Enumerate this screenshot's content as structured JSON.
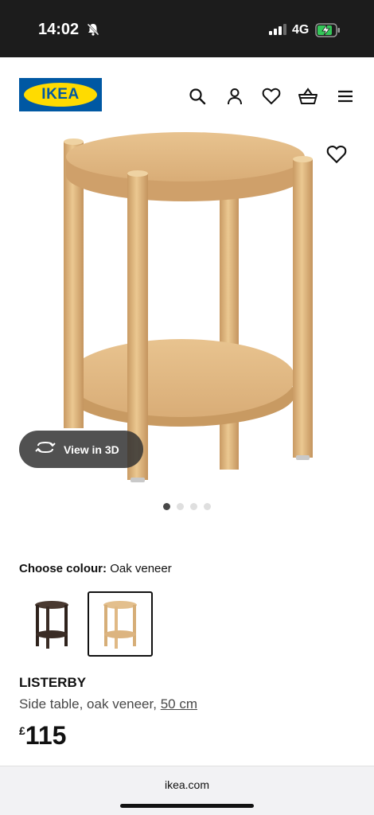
{
  "status": {
    "time": "14:02",
    "network": "4G"
  },
  "header": {
    "logo_text": "IKEA"
  },
  "gallery": {
    "view_3d_label": "View in 3D",
    "slide_count": 4,
    "active_slide": 1
  },
  "colour": {
    "label": "Choose colour:",
    "value": "Oak veneer",
    "options": [
      "dark-brown",
      "oak-veneer"
    ],
    "selected": "oak-veneer"
  },
  "product": {
    "name": "LISTERBY",
    "description": "Side table, oak veneer,",
    "size": "50 cm",
    "currency": "£",
    "price": "115"
  },
  "browser": {
    "url": "ikea.com"
  },
  "colors": {
    "brand_blue": "#0058a3",
    "brand_yellow": "#ffdb00",
    "oak": "#e3bf8d",
    "dark": "#3b2c25"
  }
}
